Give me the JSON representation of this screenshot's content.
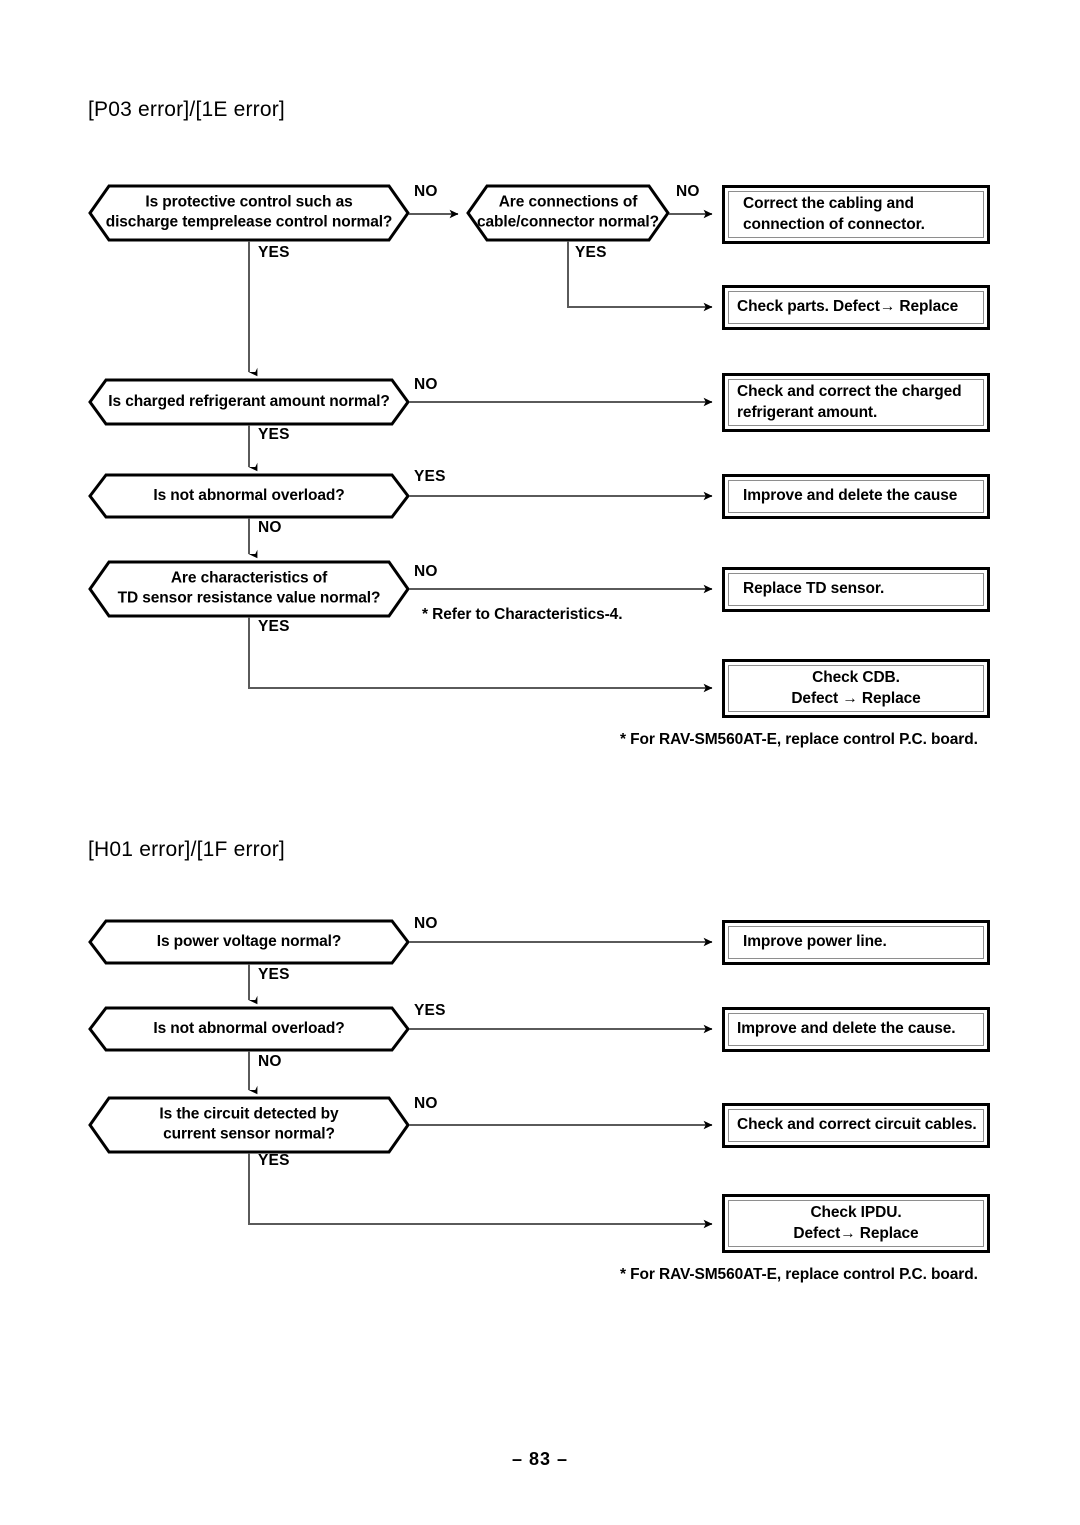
{
  "page": {
    "number_label": "– 83 –"
  },
  "sections": [
    {
      "title": "[P03 error]/[1E error]",
      "decisions": [
        {
          "text": "Is protective control such as\ndischarge temprelease control normal?"
        },
        {
          "text": "Are connections of\ncable/connector normal?"
        },
        {
          "text": "Is charged refrigerant amount normal?"
        },
        {
          "text": "Is not abnormal overload?"
        },
        {
          "text": "Are characteristics of\nTD sensor resistance value normal?"
        }
      ],
      "actions": [
        {
          "text": "Correct the cabling and\nconnection of connector."
        },
        {
          "text": "Check parts. Defect→ Replace"
        },
        {
          "text": "Check and correct the charged\nrefrigerant amount."
        },
        {
          "text": "Improve and delete the cause"
        },
        {
          "text": "Replace TD sensor."
        },
        {
          "text": "Check CDB.\nDefect → Replace"
        }
      ],
      "branches": {
        "d1_no": "NO",
        "d1_yes": "YES",
        "d2_no": "NO",
        "d2_yes": "YES",
        "d3_no": "NO",
        "d3_yes": "YES",
        "d4_yes": "YES",
        "d4_no": "NO",
        "d5_no": "NO",
        "d5_yes": "YES"
      },
      "notes": [
        {
          "text": "* Refer to Characteristics-4."
        },
        {
          "text": "* For RAV-SM560AT-E, replace control P.C. board."
        }
      ]
    },
    {
      "title": "[H01 error]/[1F error]",
      "decisions": [
        {
          "text": "Is power voltage normal?"
        },
        {
          "text": "Is not abnormal overload?"
        },
        {
          "text": "Is the circuit detected by\ncurrent sensor normal?"
        }
      ],
      "actions": [
        {
          "text": "Improve power line."
        },
        {
          "text": "Improve and delete the cause."
        },
        {
          "text": "Check and correct circuit cables."
        },
        {
          "text": "Check IPDU.\nDefect→ Replace"
        }
      ],
      "branches": {
        "d1_no": "NO",
        "d1_yes": "YES",
        "d2_yes": "YES",
        "d2_no": "NO",
        "d3_no": "NO",
        "d3_yes": "YES"
      },
      "notes": [
        {
          "text": "* For RAV-SM560AT-E, replace control P.C. board."
        }
      ]
    }
  ],
  "colors": {
    "ink": "#000000",
    "inner_border": "#8e8e8e",
    "wire": "#5a5a5a"
  }
}
